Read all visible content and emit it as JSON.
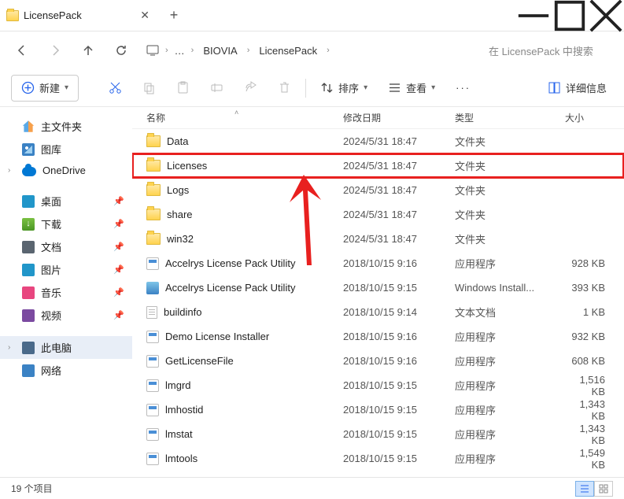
{
  "window": {
    "title": "LicensePack"
  },
  "nav": {
    "back": "←",
    "forward": "→",
    "up": "↑",
    "refresh": "⟳",
    "crumbs": [
      "BIOVIA",
      "LicensePack"
    ],
    "search_placeholder": "在 LicensePack 中搜索"
  },
  "toolbar": {
    "new_label": "新建",
    "sort_label": "排序",
    "view_label": "查看",
    "details_label": "详细信息"
  },
  "sidebar": {
    "home": "主文件夹",
    "gallery": "图库",
    "onedrive": "OneDrive",
    "desktop": "桌面",
    "downloads": "下载",
    "documents": "文档",
    "pictures": "图片",
    "music": "音乐",
    "videos": "视频",
    "pc": "此电脑",
    "network": "网络"
  },
  "columns": {
    "name": "名称",
    "date": "修改日期",
    "type": "类型",
    "size": "大小"
  },
  "files": [
    {
      "icon": "folder",
      "name": "Data",
      "date": "2024/5/31 18:47",
      "type": "文件夹",
      "size": ""
    },
    {
      "icon": "folder",
      "name": "Licenses",
      "date": "2024/5/31 18:47",
      "type": "文件夹",
      "size": "",
      "highlight": true
    },
    {
      "icon": "folder",
      "name": "Logs",
      "date": "2024/5/31 18:47",
      "type": "文件夹",
      "size": ""
    },
    {
      "icon": "folder",
      "name": "share",
      "date": "2024/5/31 18:47",
      "type": "文件夹",
      "size": ""
    },
    {
      "icon": "folder",
      "name": "win32",
      "date": "2024/5/31 18:47",
      "type": "文件夹",
      "size": ""
    },
    {
      "icon": "exe",
      "name": "Accelrys License Pack Utility",
      "date": "2018/10/15 9:16",
      "type": "应用程序",
      "size": "928 KB"
    },
    {
      "icon": "msi",
      "name": "Accelrys License Pack Utility",
      "date": "2018/10/15 9:15",
      "type": "Windows Install...",
      "size": "393 KB"
    },
    {
      "icon": "txt",
      "name": "buildinfo",
      "date": "2018/10/15 9:14",
      "type": "文本文档",
      "size": "1 KB"
    },
    {
      "icon": "exe",
      "name": "Demo License Installer",
      "date": "2018/10/15 9:16",
      "type": "应用程序",
      "size": "932 KB"
    },
    {
      "icon": "exe",
      "name": "GetLicenseFile",
      "date": "2018/10/15 9:16",
      "type": "应用程序",
      "size": "608 KB"
    },
    {
      "icon": "exe",
      "name": "lmgrd",
      "date": "2018/10/15 9:15",
      "type": "应用程序",
      "size": "1,516 KB"
    },
    {
      "icon": "exe",
      "name": "lmhostid",
      "date": "2018/10/15 9:15",
      "type": "应用程序",
      "size": "1,343 KB"
    },
    {
      "icon": "exe",
      "name": "lmstat",
      "date": "2018/10/15 9:15",
      "type": "应用程序",
      "size": "1,343 KB"
    },
    {
      "icon": "exe",
      "name": "lmtools",
      "date": "2018/10/15 9:15",
      "type": "应用程序",
      "size": "1,549 KB"
    }
  ],
  "status": {
    "count": "19 个项目"
  }
}
